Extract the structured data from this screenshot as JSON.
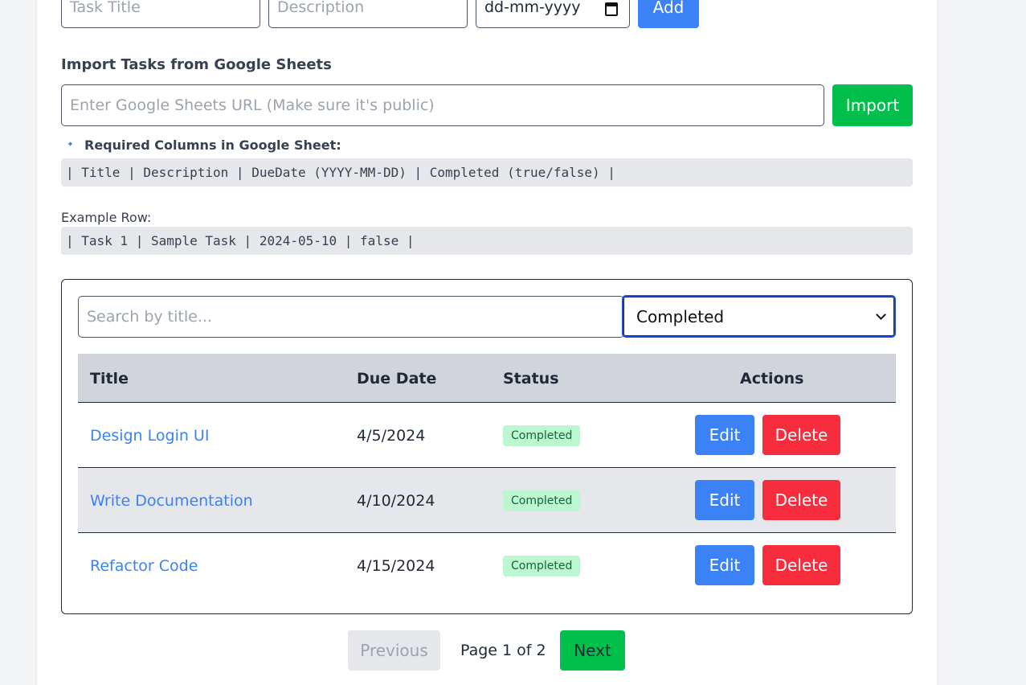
{
  "form": {
    "title_placeholder": "Task Title",
    "description_placeholder": "Description",
    "date_placeholder": "dd-mm-yyyy",
    "add_label": "Add"
  },
  "import": {
    "heading": "Import Tasks from Google Sheets",
    "url_placeholder": "Enter Google Sheets URL (Make sure it's public)",
    "import_label": "Import",
    "required_bullet": "🔹",
    "required_heading": "Required Columns in Google Sheet:",
    "columns_line": "| Title | Description | DueDate (YYYY-MM-DD) | Completed (true/false) |",
    "example_label": "Example Row:",
    "example_line": "| Task 1 | Sample Task | 2024-05-10 | false |"
  },
  "filters": {
    "search_placeholder": "Search by title...",
    "status_selected": "Completed"
  },
  "table": {
    "headers": [
      "Title",
      "Due Date",
      "Status",
      "Actions"
    ],
    "rows": [
      {
        "title": "Design Login UI",
        "due": "4/5/2024",
        "status": "Completed",
        "edit": "Edit",
        "delete": "Delete"
      },
      {
        "title": "Write Documentation",
        "due": "4/10/2024",
        "status": "Completed",
        "edit": "Edit",
        "delete": "Delete"
      },
      {
        "title": "Refactor Code",
        "due": "4/15/2024",
        "status": "Completed",
        "edit": "Edit",
        "delete": "Delete"
      }
    ]
  },
  "pagination": {
    "previous_label": "Previous",
    "page_text": "Page 1 of 2",
    "next_label": "Next"
  },
  "colors": {
    "primary": "#3b82f6",
    "danger": "#f72d3e",
    "success": "#00c04b",
    "link": "#3b82f6"
  }
}
